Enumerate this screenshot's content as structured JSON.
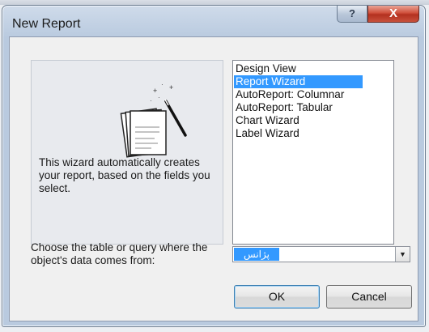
{
  "dialog": {
    "title": "New Report",
    "help_glyph": "?",
    "close_glyph": "X",
    "description": "This wizard automatically creates your report, based on the fields you select.",
    "options": [
      {
        "label": "Design View",
        "selected": false
      },
      {
        "label": "Report Wizard",
        "selected": true
      },
      {
        "label": "AutoReport:  Columnar",
        "selected": false
      },
      {
        "label": "AutoReport:  Tabular",
        "selected": false
      },
      {
        "label": "Chart Wizard",
        "selected": false
      },
      {
        "label": "Label Wizard",
        "selected": false
      }
    ],
    "source_label": "Choose the table or query where the object's data comes from:",
    "source_value": "پژانس",
    "ok_label": "OK",
    "cancel_label": "Cancel",
    "accent_color": "#3399ff",
    "icons": {
      "preview": "report-pages-with-wand-icon",
      "dropdown": "chevron-down-icon"
    }
  }
}
